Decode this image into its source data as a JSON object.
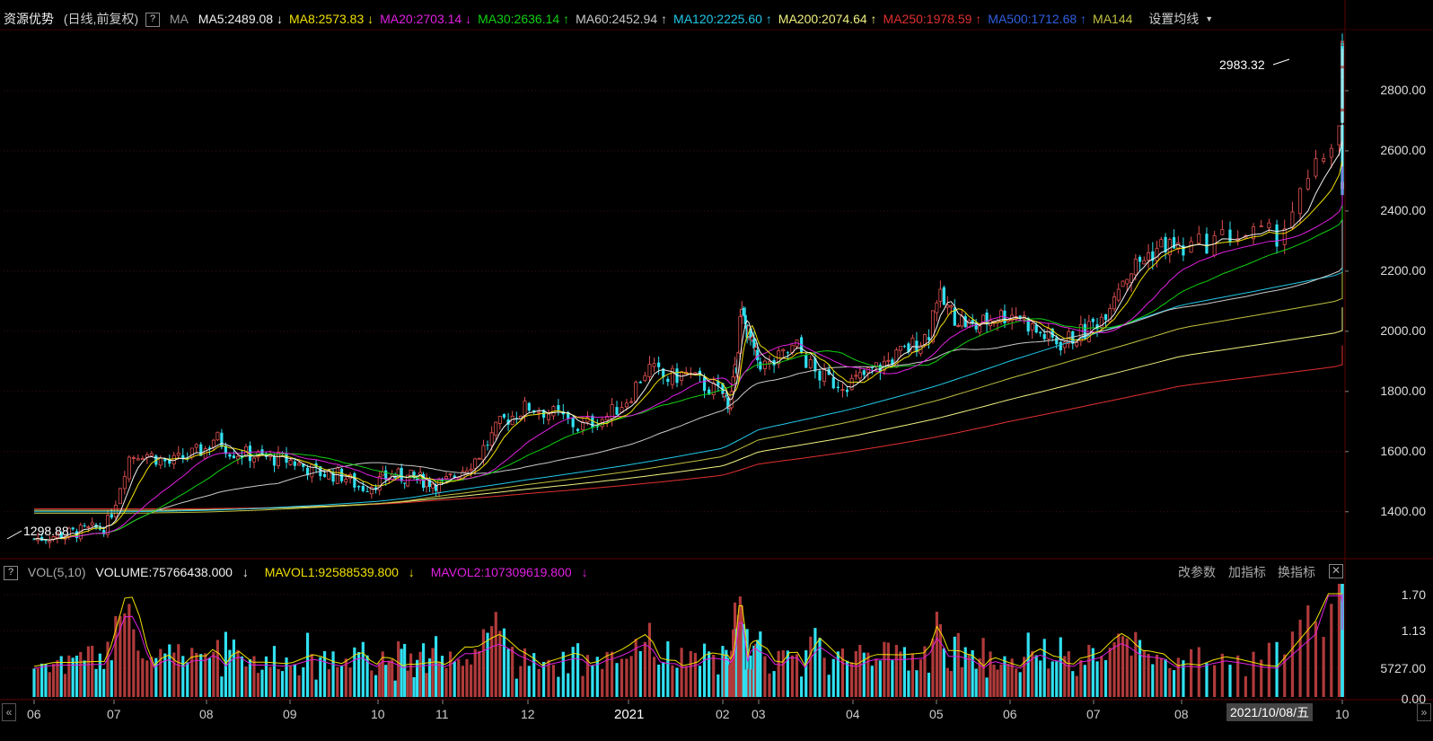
{
  "header": {
    "title": "资源优势",
    "mode": "(日线,前复权)",
    "help": "?",
    "ma_label": "MA",
    "ma_items": [
      {
        "label": "MA5:2489.08",
        "arrow": "↓",
        "color": "#f0f0f0"
      },
      {
        "label": "MA8:2573.83",
        "arrow": "↓",
        "color": "#f0e000"
      },
      {
        "label": "MA20:2703.14",
        "arrow": "↓",
        "color": "#e020e0"
      },
      {
        "label": "MA30:2636.14",
        "arrow": "↑",
        "color": "#10d010"
      },
      {
        "label": "MA60:2452.94",
        "arrow": "↑",
        "color": "#c8c8c8"
      },
      {
        "label": "MA120:2225.60",
        "arrow": "↑",
        "color": "#20c8e8"
      },
      {
        "label": "MA200:2074.64",
        "arrow": "↑",
        "color": "#f0f080"
      },
      {
        "label": "MA250:1978.59",
        "arrow": "↑",
        "color": "#e03030"
      },
      {
        "label": "MA500:1712.68",
        "arrow": "↑",
        "color": "#3060e0"
      },
      {
        "label": "MA144",
        "arrow": "",
        "color": "#c0c040"
      }
    ],
    "settings": "设置均线"
  },
  "price_axis": [
    "2800.00",
    "2600.00",
    "2400.00",
    "2200.00",
    "2000.00",
    "1800.00",
    "1600.00",
    "1400.00"
  ],
  "annotations": {
    "high": "2983.32",
    "low": "1298.88"
  },
  "volume_header": {
    "help": "?",
    "label": "VOL(5,10)",
    "volume": "VOLUME:75766438.000",
    "volume_arrow": "↓",
    "mavol1": "MAVOL1:92588539.800",
    "mavol1_arrow": "↓",
    "mavol2": "MAVOL2:107309619.800",
    "mavol2_arrow": "↓",
    "btn_params": "改参数",
    "btn_add": "加指标",
    "btn_switch": "换指标",
    "btn_close": "✕"
  },
  "volume_axis": [
    "1.70",
    "1.13",
    "5727.00",
    "0.00"
  ],
  "x_axis": [
    "06",
    "07",
    "08",
    "09",
    "10",
    "11",
    "12",
    "2021",
    "02",
    "03",
    "04",
    "05",
    "06",
    "07",
    "08",
    "10"
  ],
  "date_box": "2021/10/08/五",
  "colors": {
    "up": "#e05050",
    "down": "#30e0f0",
    "grid": "#3a0000"
  },
  "chart_data": {
    "type": "candlestick",
    "title": "资源优势",
    "ylim": [
      1250,
      3000
    ],
    "months": [
      "06",
      "07",
      "08",
      "09",
      "10",
      "11",
      "12",
      "2021",
      "02",
      "03",
      "04",
      "05",
      "06",
      "07",
      "08",
      "10"
    ],
    "close_path": [
      [
        0,
        1310
      ],
      [
        0.5,
        1330
      ],
      [
        0.9,
        1350
      ],
      [
        1.0,
        1420
      ],
      [
        1.15,
        1580
      ],
      [
        1.3,
        1600
      ],
      [
        1.6,
        1560
      ],
      [
        2.0,
        1610
      ],
      [
        2.1,
        1650
      ],
      [
        2.3,
        1600
      ],
      [
        2.7,
        1580
      ],
      [
        3.0,
        1570
      ],
      [
        3.3,
        1530
      ],
      [
        3.6,
        1520
      ],
      [
        3.8,
        1480
      ],
      [
        4.2,
        1520
      ],
      [
        4.6,
        1510
      ],
      [
        5.0,
        1490
      ],
      [
        5.4,
        1580
      ],
      [
        5.7,
        1700
      ],
      [
        6.0,
        1750
      ],
      [
        6.3,
        1720
      ],
      [
        6.5,
        1680
      ],
      [
        6.8,
        1720
      ],
      [
        7.0,
        1780
      ],
      [
        7.2,
        1880
      ],
      [
        7.4,
        1840
      ],
      [
        7.6,
        1860
      ],
      [
        7.8,
        1820
      ],
      [
        8.0,
        1790
      ],
      [
        8.2,
        1760
      ],
      [
        8.4,
        1900
      ],
      [
        8.5,
        2060
      ],
      [
        8.7,
        2000
      ],
      [
        8.9,
        1920
      ],
      [
        9.1,
        1880
      ],
      [
        9.4,
        1950
      ],
      [
        9.6,
        1860
      ],
      [
        9.8,
        1830
      ],
      [
        10.0,
        1830
      ],
      [
        10.3,
        1880
      ],
      [
        10.6,
        1930
      ],
      [
        10.9,
        1990
      ],
      [
        11.0,
        2120
      ],
      [
        11.2,
        2060
      ],
      [
        11.5,
        2010
      ],
      [
        11.8,
        2050
      ],
      [
        12.1,
        2060
      ],
      [
        12.3,
        2000
      ],
      [
        12.6,
        1960
      ],
      [
        12.9,
        2000
      ],
      [
        13.1,
        2050
      ],
      [
        13.3,
        2170
      ],
      [
        13.6,
        2250
      ],
      [
        13.8,
        2290
      ],
      [
        14.0,
        2270
      ],
      [
        14.3,
        2320
      ],
      [
        14.6,
        2320
      ],
      [
        14.8,
        2500
      ],
      [
        15.0,
        2700
      ],
      [
        15.2,
        2760
      ],
      [
        15.4,
        2900
      ],
      [
        15.55,
        2950
      ],
      [
        15.7,
        2800
      ],
      [
        15.85,
        2520
      ],
      [
        15.95,
        2490
      ]
    ]
  }
}
